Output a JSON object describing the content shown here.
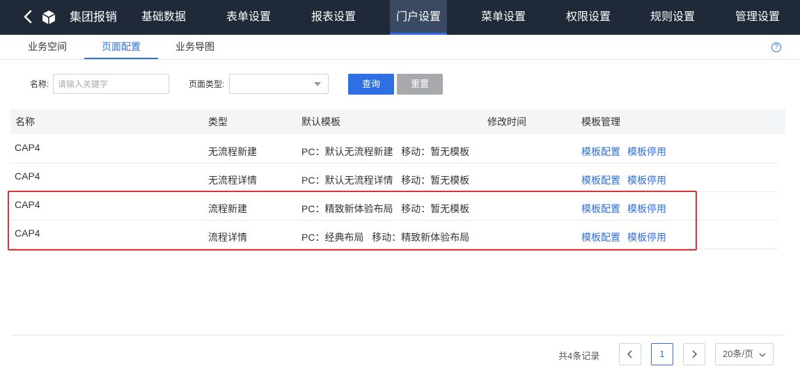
{
  "topbar": {
    "app_title": "集团报销",
    "nav": [
      "基础数据",
      "表单设置",
      "报表设置",
      "门户设置",
      "菜单设置",
      "权限设置",
      "规则设置",
      "管理设置"
    ],
    "active_nav": "门户设置"
  },
  "subtabs": [
    "业务空间",
    "页面配置",
    "业务导图"
  ],
  "active_subtab": "页面配置",
  "filter": {
    "name_label": "名称:",
    "name_placeholder": "请输入关键字",
    "name_value": "",
    "type_label": "页面类型:",
    "type_value": "",
    "query_label": "查询",
    "reset_label": "重置"
  },
  "table": {
    "columns": [
      "名称",
      "类型",
      "默认模板",
      "修改时间",
      "模板管理"
    ],
    "rows": [
      {
        "name": "CAP4",
        "type": "无流程新建",
        "template": "PC：默认无流程新建   移动：暂无模板",
        "modified": "",
        "action1": "模板配置",
        "action2": "模板停用"
      },
      {
        "name": "CAP4",
        "type": "无流程详情",
        "template": "PC：默认无流程详情   移动：暂无模板",
        "modified": "",
        "action1": "模板配置",
        "action2": "模板停用"
      },
      {
        "name": "CAP4",
        "type": "流程新建",
        "template": "PC：精致新体验布局   移动：暂无模板",
        "modified": "",
        "action1": "模板配置",
        "action2": "模板停用"
      },
      {
        "name": "CAP4",
        "type": "流程详情",
        "template": "PC：经典布局   移动：精致新体验布局",
        "modified": "",
        "action1": "模板配置",
        "action2": "模板停用"
      }
    ]
  },
  "pagination": {
    "total": "共4条记录",
    "current_page": "1",
    "page_size": "20条/页"
  },
  "colors": {
    "topbar_bg": "#1f2937",
    "accent": "#2f6fe4",
    "highlight_box": "#d9323a"
  }
}
